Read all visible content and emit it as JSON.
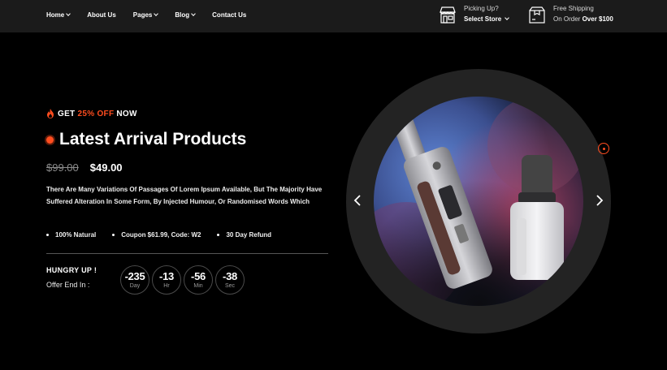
{
  "nav": {
    "items": [
      {
        "label": "Home",
        "has_dropdown": true
      },
      {
        "label": "About Us",
        "has_dropdown": false
      },
      {
        "label": "Pages",
        "has_dropdown": true
      },
      {
        "label": "Blog",
        "has_dropdown": true
      },
      {
        "label": "Contact Us",
        "has_dropdown": false
      }
    ]
  },
  "pickup": {
    "icon": "store-icon",
    "label": "Picking Up?",
    "select_label": "Select Store"
  },
  "shipping": {
    "icon": "box-icon",
    "label": "Free Shipping",
    "prefix": "On Order",
    "amount": "Over $100"
  },
  "hero": {
    "promo_prefix": "GET",
    "promo_accent": "25% OFF",
    "promo_suffix": "NOW",
    "headline": "Latest Arrival Products",
    "price_old": "$99.00",
    "price_new": "$49.00",
    "description": "There Are Many Variations Of Passages Of Lorem Ipsum Available, But The Majority Have Suffered Alteration In Some Form, By Injected Humour, Or Randomised Words Which",
    "features": [
      "100% Natural",
      "Coupon $61.99, Code: W2",
      "30 Day Refund"
    ],
    "offer_title": "HUNGRY UP !",
    "offer_sub": "Offer End In :",
    "countdown": [
      {
        "value": "-235",
        "unit": "Day"
      },
      {
        "value": "-13",
        "unit": "Hr"
      },
      {
        "value": "-56",
        "unit": "Min"
      },
      {
        "value": "-38",
        "unit": "Sec"
      }
    ]
  },
  "colors": {
    "accent": "#ff4d1f",
    "background": "#000000",
    "topbar": "#1b1b1b",
    "ring": "#232323"
  }
}
